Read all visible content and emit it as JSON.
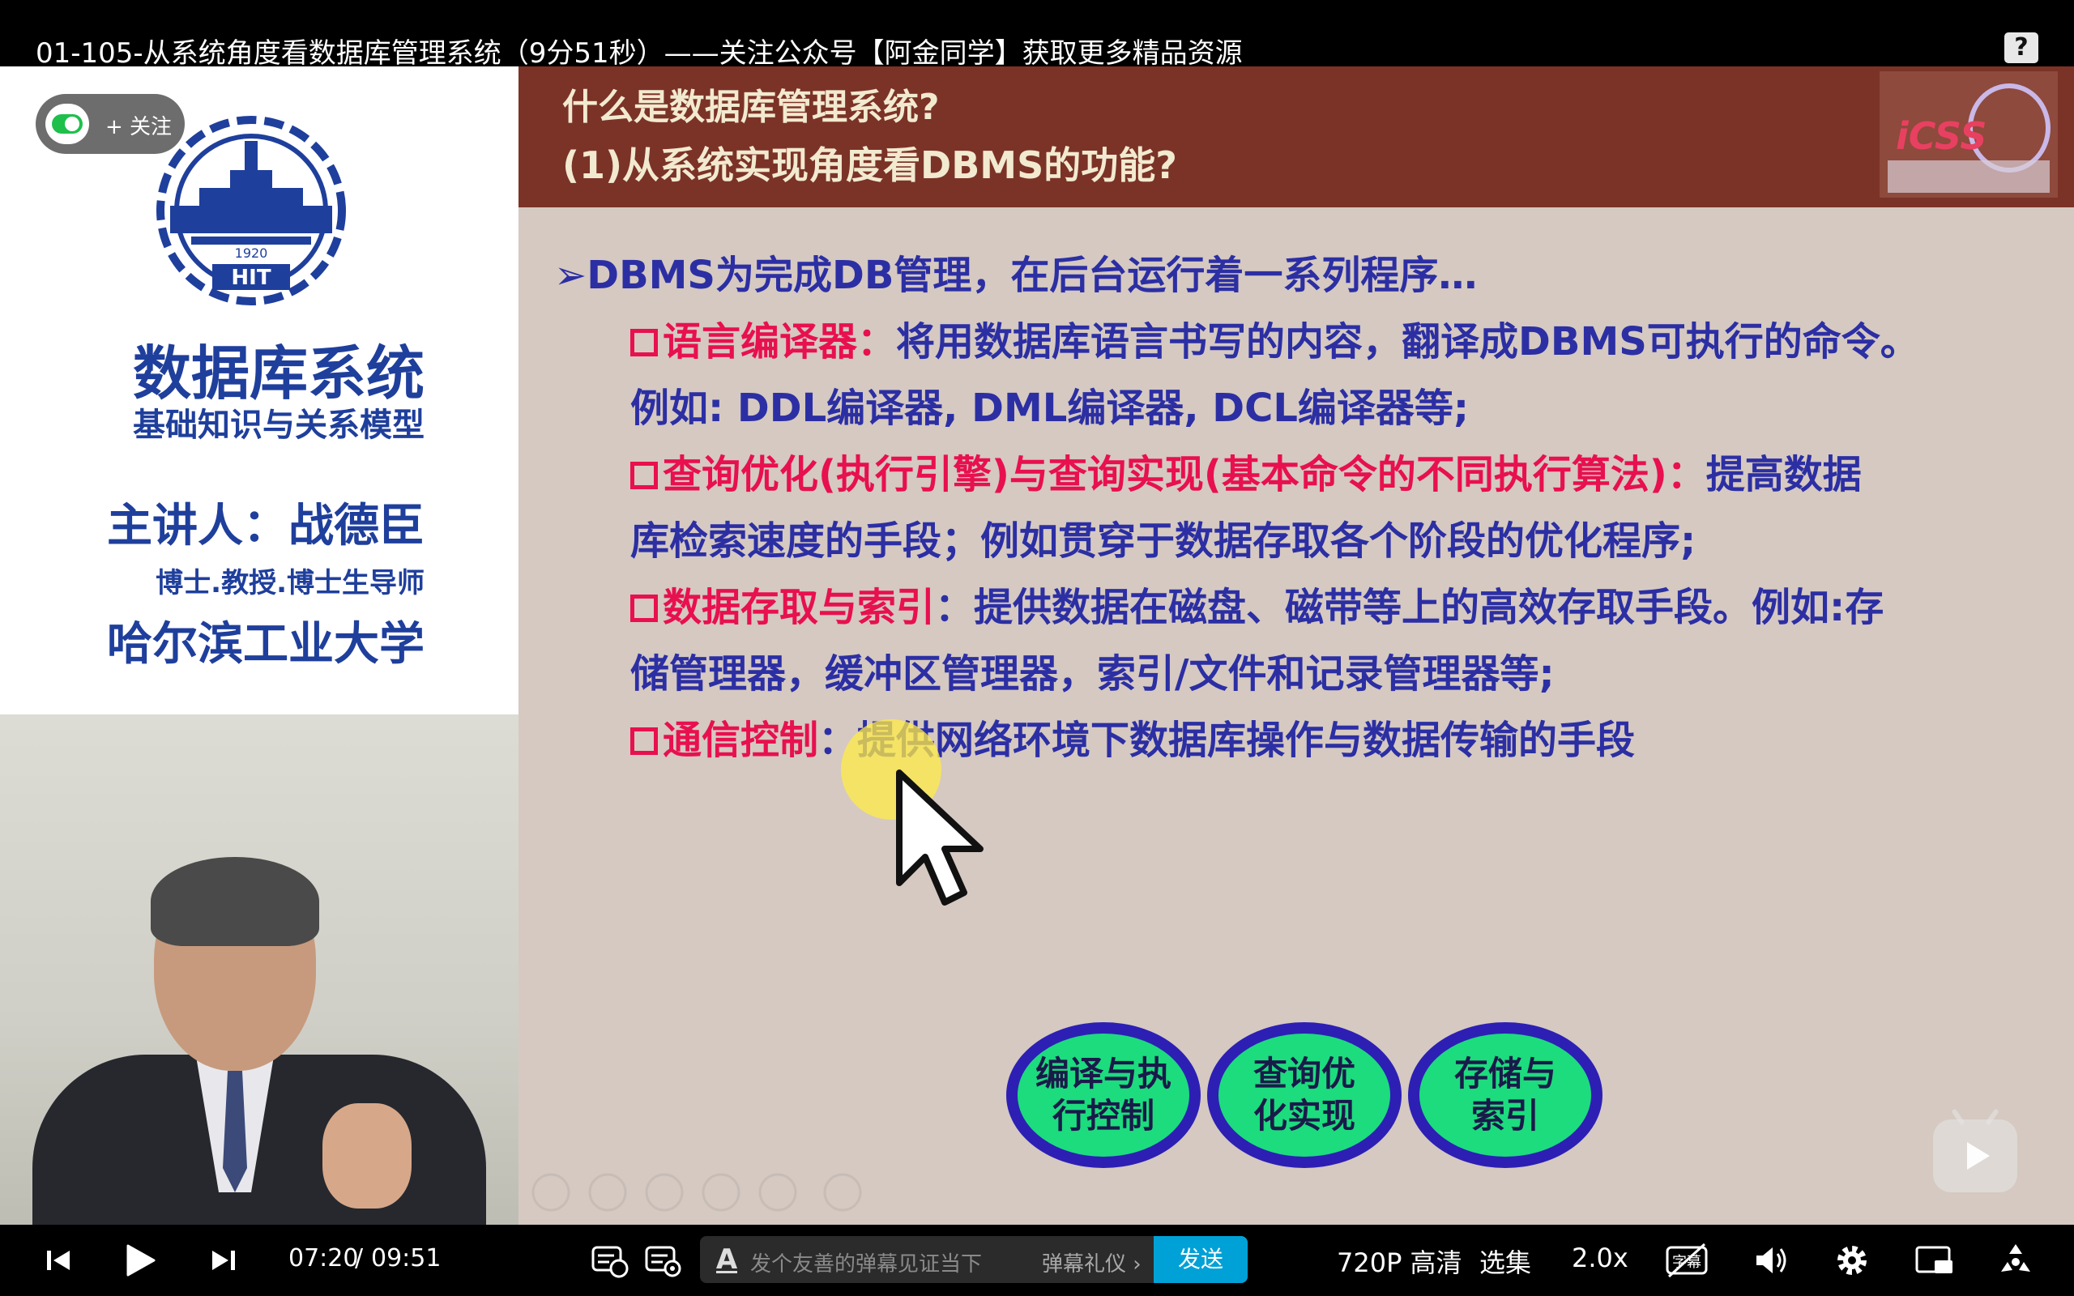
{
  "window": {
    "title": "01-105-从系统角度看数据库管理系统（9分51秒）——关注公众号【阿金同学】获取更多精品资源",
    "help_label": "?"
  },
  "follow": {
    "label": "+ 关注"
  },
  "left_panel": {
    "logo_text": "HIT",
    "logo_year": "1920",
    "course_title": "数据库系统",
    "course_subtitle": "基础知识与关系模型",
    "lecturer": "主讲人：战德臣",
    "lecturer_title": "博士.教授.博士生导师",
    "university": "哈尔滨工业大学"
  },
  "slide": {
    "question": "什么是数据库管理系统?",
    "subquestion": "(1)从系统实现角度看DBMS的功能?",
    "header_logo_text": "iCSS",
    "main_bullet": "DBMS为完成DB管理，在后台运行着一系列程序…",
    "items": [
      {
        "title": "语言编译器：",
        "text": "将用数据库语言书写的内容，翻译成DBMS可执行的命令。",
        "cont": "例如: DDL编译器, DML编译器, DCL编译器等;"
      },
      {
        "title": "查询优化(执行引擎)与查询实现(基本命令的不同执行算法)：",
        "text": "提高数据",
        "cont": "库检索速度的手段；例如贯穿于数据存取各个阶段的优化程序;"
      },
      {
        "title": "数据存取与索引",
        "text": "：提供数据在磁盘、磁带等上的高效存取手段。例如:存",
        "cont": "储管理器，缓冲区管理器，索引/文件和记录管理器等;"
      },
      {
        "title": "通信控制",
        "text": "：提供网络环境下数据库操作与数据传输的手段",
        "cont": ""
      }
    ],
    "buttons": [
      {
        "line1": "编译与执",
        "line2": "行控制"
      },
      {
        "line1": "查询优",
        "line2": "化实现"
      },
      {
        "line1": "存储与",
        "line2": "索引"
      }
    ]
  },
  "playback": {
    "current_time": "07:20",
    "separator": "/",
    "duration": "09:51",
    "progress_fraction": 0.745
  },
  "danmaku": {
    "placeholder": "发个友善的弹幕见证当下",
    "etiquette": "弹幕礼仪 ›",
    "send": "发送"
  },
  "controls": {
    "quality": "720P 高清",
    "episodes": "选集",
    "speed": "2.0x",
    "subtitle_label": "字幕"
  },
  "colors": {
    "accent": "#00a1d6",
    "slide_header": "#7b3327",
    "slide_text": "#2c2fa3",
    "slide_highlight": "#e8104f",
    "button_fill": "#1cdc7e",
    "button_ring": "#2d1fb4"
  },
  "icons": [
    "help-icon",
    "toggle-icon",
    "prev-icon",
    "play-icon",
    "next-icon",
    "danmaku-settings-icon",
    "danmaku-toggle-icon",
    "text-style-icon",
    "subtitle-icon",
    "volume-icon",
    "settings-icon",
    "picture-in-picture-icon",
    "fullscreen-icon",
    "floating-play-icon",
    "cursor-icon"
  ]
}
